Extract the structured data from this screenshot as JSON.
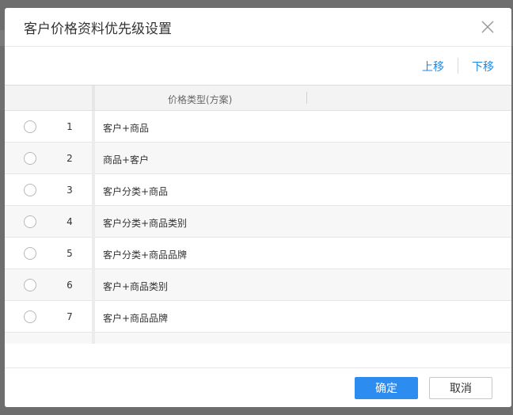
{
  "dialog": {
    "title": "客户价格资料优先级设置",
    "close_icon": "close-icon"
  },
  "toolbar": {
    "move_up": "上移",
    "move_down": "下移"
  },
  "grid": {
    "column_header": "价格类型(方案)",
    "rows": [
      {
        "num": "1",
        "label": "客户+商品"
      },
      {
        "num": "2",
        "label": "商品+客户"
      },
      {
        "num": "3",
        "label": "客户分类+商品"
      },
      {
        "num": "4",
        "label": "客户分类+商品类别"
      },
      {
        "num": "5",
        "label": "客户分类+商品品牌"
      },
      {
        "num": "6",
        "label": "客户+商品类别"
      },
      {
        "num": "7",
        "label": "客户+商品品牌"
      }
    ]
  },
  "footer": {
    "ok": "确定",
    "cancel": "取消"
  },
  "colors": {
    "accent": "#2d8cf0",
    "link": "#1e88e5"
  }
}
